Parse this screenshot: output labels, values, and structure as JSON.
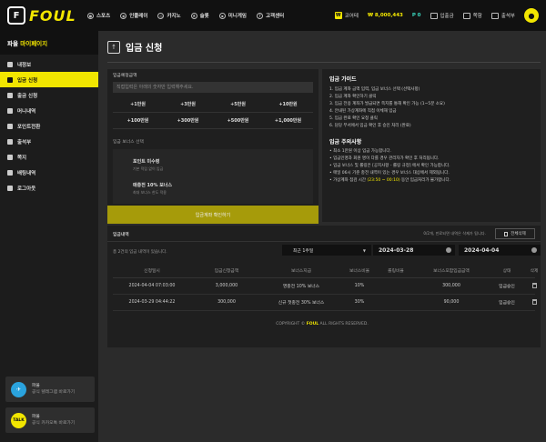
{
  "header": {
    "logo_text": "FOUL",
    "nav": [
      {
        "label": "스포츠",
        "icon": "sports-icon"
      },
      {
        "label": "인플레이",
        "icon": "inplay-icon"
      },
      {
        "label": "카지노",
        "icon": "casino-icon"
      },
      {
        "label": "슬롯",
        "icon": "slot-icon"
      },
      {
        "label": "미니게임",
        "icon": "minigame-icon"
      },
      {
        "label": "고객센터",
        "icon": "support-icon"
      }
    ],
    "badge_symbol": "₩",
    "user_name": "코어테",
    "money": "₩ 8,000,443",
    "point_label": "P",
    "point_value": "0",
    "deposit_label": "입출금",
    "mail_label": "쪽함",
    "attendance_label": "출석부"
  },
  "sidebar": {
    "title_prefix": "파울",
    "title_highlight": "마이페이지",
    "items": [
      {
        "label": "내정보",
        "active": false
      },
      {
        "label": "입금 신청",
        "active": true
      },
      {
        "label": "출금 신청",
        "active": false
      },
      {
        "label": "머니내역",
        "active": false
      },
      {
        "label": "포인트전환",
        "active": false
      },
      {
        "label": "출석부",
        "active": false
      },
      {
        "label": "쪽지",
        "active": false
      },
      {
        "label": "배팅내역",
        "active": false
      },
      {
        "label": "로그아웃",
        "active": false
      }
    ],
    "promos": [
      {
        "title": "파울",
        "subtitle": "공식 텔레그램 바로가기",
        "icon_text": "✈",
        "color": "#2aa3de"
      },
      {
        "title": "파울",
        "subtitle": "공식 카카오톡 바로가기",
        "icon_text": "TALK",
        "color": "#f2e600"
      }
    ]
  },
  "page": {
    "title": "입금 신청",
    "form": {
      "label": "입금예정금액",
      "placeholder": "직접입력은 아래의 숫자만 입력해주세요.",
      "amounts": [
        "+1만원",
        "+3만원",
        "+5만원",
        "+10만원",
        "+100만원",
        "+300만원",
        "+500만원",
        "+1,000만원"
      ],
      "bonus_label": "입금 보너스 선택",
      "bonus_options": [
        {
          "title": "포인트 미수령",
          "sub": "기본 적립 없이 입금"
        },
        {
          "title": "매충전 10% 보너스",
          "sub": "최대 보너스 한도 적용"
        }
      ],
      "confirm_label": "입금계좌 확인하기"
    },
    "guide": {
      "title": "입금 가이드",
      "steps": [
        "1. 입금 계좌 금액 입력, 입금 보너스 선택 (선택사항)",
        "2. 입금 계좌 확인하기 클릭",
        "3. 입금 전용 계좌가 발급되면 쪽지를 통해 확인 가능 (1~5분 소요)",
        "4. 안내된 가상계좌에 직접 이체해 입금",
        "5. 입금 완료 확인 요청 클릭",
        "6. 담당 부서에서 입금 확인 후 승인 처리 (완료)"
      ],
      "notice_title": "입금 주의사항",
      "notices": [
        "최소 1만원 이상 입금 가능합니다.",
        "입금인명과 회원 명이 다를 경우 관리자가 확인 후 처리됩니다.",
        "입금 보너스 및 롤링은 [공지사항 - 롤링 규정] 에서 확인 가능합니다.",
        "매일 06시 기준 충전 내역이 있는 경우 보너스 대상에서 제외됩니다."
      ],
      "maint_prefix": "가상계좌 점검 시간",
      "maint_time": "(23:50 ~ 00:10)",
      "maint_suffix": "동안 입금처리가 불가합니다."
    },
    "history": {
      "title": "입금내역",
      "info": "0/2개, 만료되면 내역은 삭제가 됩니다.",
      "delete_label": "전체삭제",
      "count_text": "총 2건의 입금 내역이 있습니다.",
      "period": "최근 1주일",
      "date_from": "2024-03-28",
      "date_to": "2024-04-04",
      "columns": [
        "신청일시",
        "입금신청금액",
        "보너스지급",
        "보너스비율",
        "롤링비율",
        "보너스포함입금금액",
        "상태",
        "삭제"
      ],
      "rows": [
        [
          "2024-04-04 07:03:00",
          "3,000,000",
          "영충전 10% 보너스",
          "10%",
          "",
          "300,000",
          "입금승인"
        ],
        [
          "2024-03-29 04:44:22",
          "300,000",
          "신규 첫충전 30% 보너스",
          "30%",
          "",
          "90,000",
          "입금승인"
        ]
      ]
    },
    "footer": {
      "prefix": "COPYRIGHT ©",
      "brand": "FOUL",
      "suffix": "ALL RIGHTS RESERVED."
    }
  }
}
